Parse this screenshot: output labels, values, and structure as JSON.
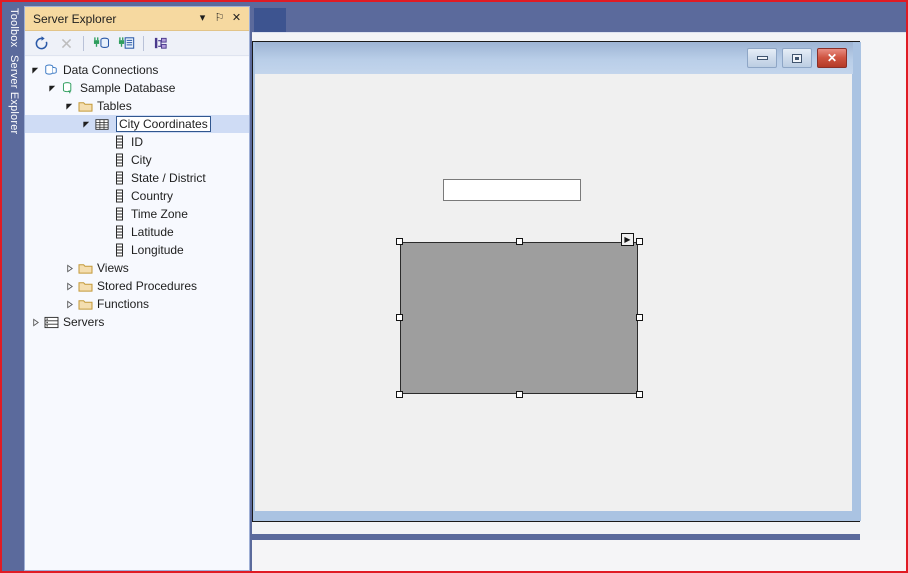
{
  "vertical_tabs": [
    {
      "label": "Toolbox",
      "name": "toolbox",
      "selected": false
    },
    {
      "label": "Server Explorer",
      "name": "server-explorer",
      "selected": true
    }
  ],
  "server_explorer": {
    "title": "Server Explorer",
    "header_buttons": [
      {
        "name": "window-dropdown",
        "glyph": "▾"
      },
      {
        "name": "pin",
        "glyph": "⚐"
      },
      {
        "name": "close",
        "glyph": "✕"
      }
    ],
    "toolbar": [
      {
        "name": "refresh-icon",
        "enabled": true
      },
      {
        "name": "stop-icon",
        "enabled": false
      },
      {
        "name": "connect-to-database-icon",
        "enabled": true
      },
      {
        "name": "connect-to-server-icon",
        "enabled": true
      },
      {
        "name": "object-hierarchy-icon",
        "enabled": true
      }
    ],
    "tree": [
      {
        "label": "Data Connections",
        "indent": 0,
        "expander": "expanded",
        "icon": "database-stack-icon",
        "selected": false,
        "editing": false
      },
      {
        "label": "Sample Database",
        "indent": 1,
        "expander": "expanded",
        "icon": "database-connection-icon",
        "selected": false,
        "editing": false
      },
      {
        "label": "Tables",
        "indent": 2,
        "expander": "expanded",
        "icon": "folder-icon",
        "selected": false,
        "editing": false
      },
      {
        "label": "City Coordinates",
        "indent": 3,
        "expander": "expanded",
        "icon": "table-icon",
        "selected": true,
        "editing": true
      },
      {
        "label": "ID",
        "indent": 4,
        "expander": "none",
        "icon": "column-icon",
        "selected": false,
        "editing": false
      },
      {
        "label": "City",
        "indent": 4,
        "expander": "none",
        "icon": "column-icon",
        "selected": false,
        "editing": false
      },
      {
        "label": "State / District",
        "indent": 4,
        "expander": "none",
        "icon": "column-icon",
        "selected": false,
        "editing": false
      },
      {
        "label": "Country",
        "indent": 4,
        "expander": "none",
        "icon": "column-icon",
        "selected": false,
        "editing": false
      },
      {
        "label": "Time Zone",
        "indent": 4,
        "expander": "none",
        "icon": "column-icon",
        "selected": false,
        "editing": false
      },
      {
        "label": "Latitude",
        "indent": 4,
        "expander": "none",
        "icon": "column-icon",
        "selected": false,
        "editing": false
      },
      {
        "label": "Longitude",
        "indent": 4,
        "expander": "none",
        "icon": "column-icon",
        "selected": false,
        "editing": false
      },
      {
        "label": "Views",
        "indent": 2,
        "expander": "collapsed",
        "icon": "folder-icon",
        "selected": false,
        "editing": false
      },
      {
        "label": "Stored Procedures",
        "indent": 2,
        "expander": "collapsed",
        "icon": "folder-icon",
        "selected": false,
        "editing": false
      },
      {
        "label": "Functions",
        "indent": 2,
        "expander": "collapsed",
        "icon": "folder-icon",
        "selected": false,
        "editing": false
      },
      {
        "label": "Servers",
        "indent": 0,
        "expander": "collapsed",
        "icon": "servers-icon",
        "selected": false,
        "editing": false
      }
    ]
  },
  "document_tabs": [
    {
      "label": "",
      "name": "designer-tab",
      "active": true
    }
  ],
  "designer": {
    "form_title": "",
    "window_buttons": [
      {
        "name": "minimize-button",
        "glyph": ""
      },
      {
        "name": "maximize-button",
        "glyph": ""
      },
      {
        "name": "close-button",
        "glyph": "✕"
      }
    ],
    "controls": [
      {
        "name": "textbox",
        "type": "textbox",
        "value": "",
        "placeholder": "",
        "selected": false
      },
      {
        "name": "panel",
        "type": "panel",
        "value": "",
        "selected": true,
        "handle_count": 8
      }
    ]
  },
  "colors": {
    "shell_blue": "#5b6a9c",
    "panel_header_amber": "#f6d9a0",
    "selection_blue": "#cfdcf5",
    "form_titlebar": "#aac3e2",
    "control_gray": "#9e9e9e",
    "outline_red": "#e01b24"
  }
}
